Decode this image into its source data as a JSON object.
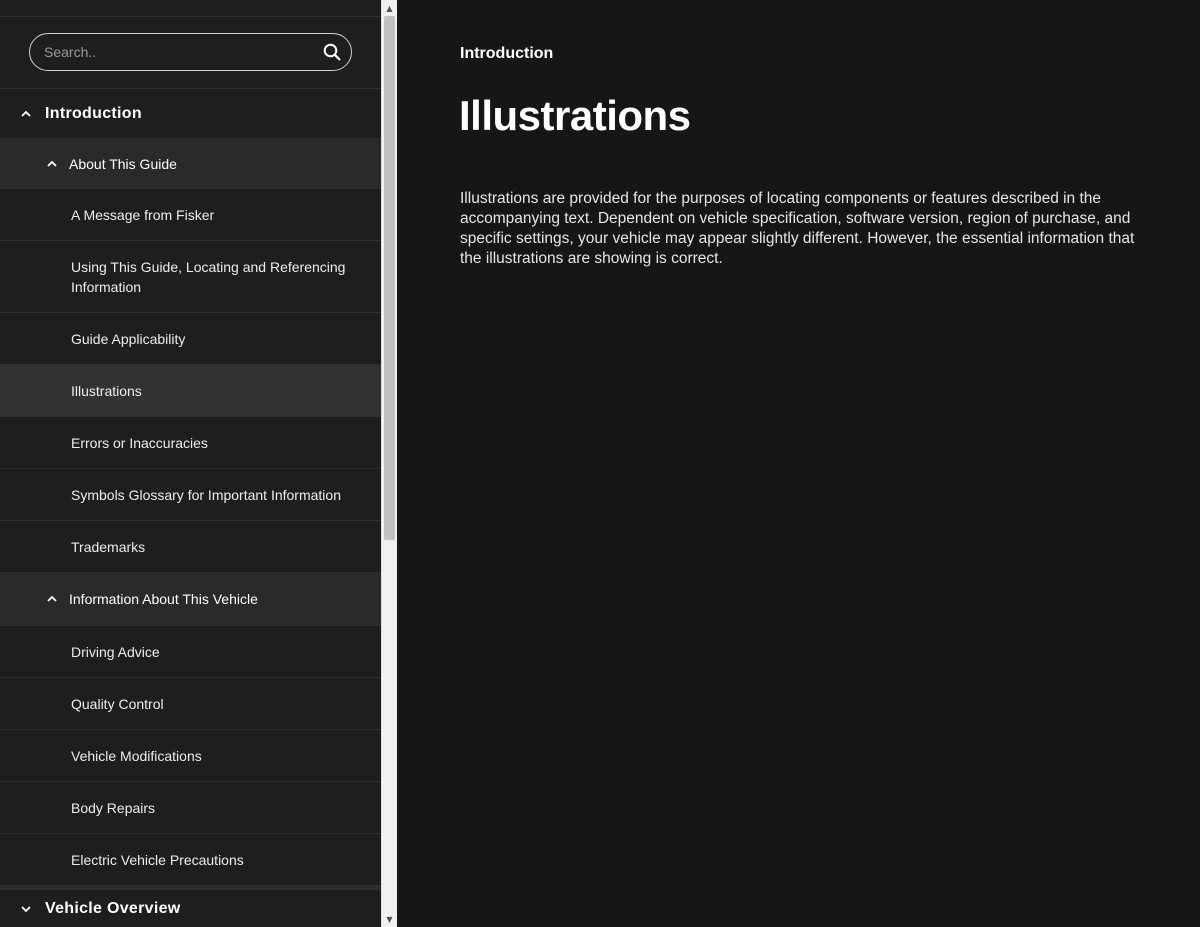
{
  "search": {
    "placeholder": "Search.."
  },
  "sidebar": {
    "sections": [
      {
        "label": "Introduction",
        "expanded": true,
        "subsections": [
          {
            "label": "About This Guide",
            "expanded": true,
            "items": [
              {
                "label": "A Message from Fisker"
              },
              {
                "label": "Using This Guide, Locating and Referencing Information"
              },
              {
                "label": "Guide Applicability"
              },
              {
                "label": "Illustrations",
                "active": true
              },
              {
                "label": "Errors or Inaccuracies"
              },
              {
                "label": "Symbols Glossary for Important Information"
              },
              {
                "label": "Trademarks"
              }
            ]
          },
          {
            "label": "Information About This Vehicle",
            "expanded": true,
            "items": [
              {
                "label": "Driving Advice"
              },
              {
                "label": "Quality Control"
              },
              {
                "label": "Vehicle Modifications"
              },
              {
                "label": "Body Repairs"
              },
              {
                "label": "Electric Vehicle Precautions"
              }
            ]
          }
        ]
      },
      {
        "label": "Vehicle Overview",
        "expanded": false
      }
    ]
  },
  "main": {
    "breadcrumb": "Introduction",
    "title": "Illustrations",
    "body": "Illustrations are provided for the purposes of locating components or features described in the accompanying text. Dependent on vehicle specification, software version, region of purchase, and specific settings, your vehicle may appear slightly different. However, the essential information that the illustrations are showing is correct."
  },
  "icons": {
    "search": "search-icon",
    "expanded": "chevron-up-icon",
    "collapsed": "chevron-down-icon"
  },
  "colors": {
    "sidebar_bg": "#1e1e20",
    "main_bg": "#161618",
    "active_item_bg": "#323234",
    "subsection_bg": "#2a2a2c"
  }
}
